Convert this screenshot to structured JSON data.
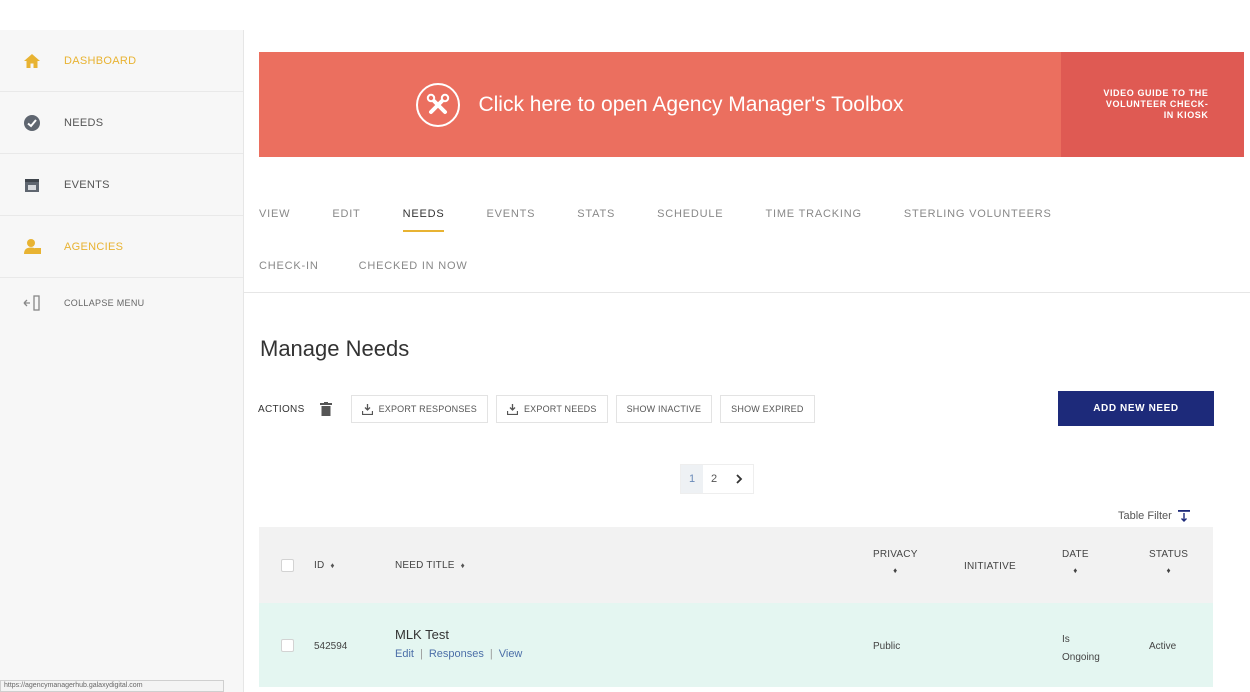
{
  "sidebar": {
    "items": [
      {
        "label": "DASHBOARD",
        "icon": "home-icon"
      },
      {
        "label": "NEEDS",
        "icon": "check-circle-icon"
      },
      {
        "label": "EVENTS",
        "icon": "calendar-icon"
      },
      {
        "label": "AGENCIES",
        "icon": "agency-icon"
      },
      {
        "label": "COLLAPSE MENU",
        "icon": "collapse-icon"
      }
    ]
  },
  "banner": {
    "text": "Click here to open Agency Manager's Toolbox",
    "side_text": "VIDEO GUIDE TO THE VOLUNTEER CHECK-IN KIOSK",
    "main_color": "#eb6f5f",
    "side_color": "#df5a53"
  },
  "tabs": {
    "row1": [
      "VIEW",
      "EDIT",
      "NEEDS",
      "EVENTS",
      "STATS",
      "SCHEDULE",
      "TIME TRACKING",
      "STERLING VOLUNTEERS"
    ],
    "row2": [
      "CHECK-IN",
      "CHECKED IN NOW"
    ],
    "active": "NEEDS",
    "accent_color": "#e8b332"
  },
  "main": {
    "heading": "Manage Needs",
    "actions_label": "ACTIONS",
    "buttons": {
      "export_responses": "EXPORT RESPONSES",
      "export_needs": "EXPORT NEEDS",
      "show_inactive": "SHOW INACTIVE",
      "show_expired": "SHOW EXPIRED",
      "add_new_need": "ADD NEW NEED"
    },
    "add_button_color": "#1d2a7a"
  },
  "pagination": {
    "pages": [
      "1",
      "2"
    ],
    "current": "1",
    "next": "›"
  },
  "table_filter": "Table Filter",
  "table": {
    "headers": {
      "id": "ID",
      "need_title": "NEED TITLE",
      "privacy": "PRIVACY",
      "initiative": "INITIATIVE",
      "date": "DATE",
      "status": "STATUS"
    },
    "sort_glyph": "♦",
    "rows": [
      {
        "id": "542594",
        "title": "MLK Test",
        "links": [
          "Edit",
          "Responses",
          "View"
        ],
        "privacy": "Public",
        "initiative": "",
        "date_line1": "Is",
        "date_line2": "Ongoing",
        "status": "Active"
      }
    ],
    "row_color": "#e4f6f1"
  },
  "statusbar": "https://agencymanagerhub.galaxydigital.com"
}
